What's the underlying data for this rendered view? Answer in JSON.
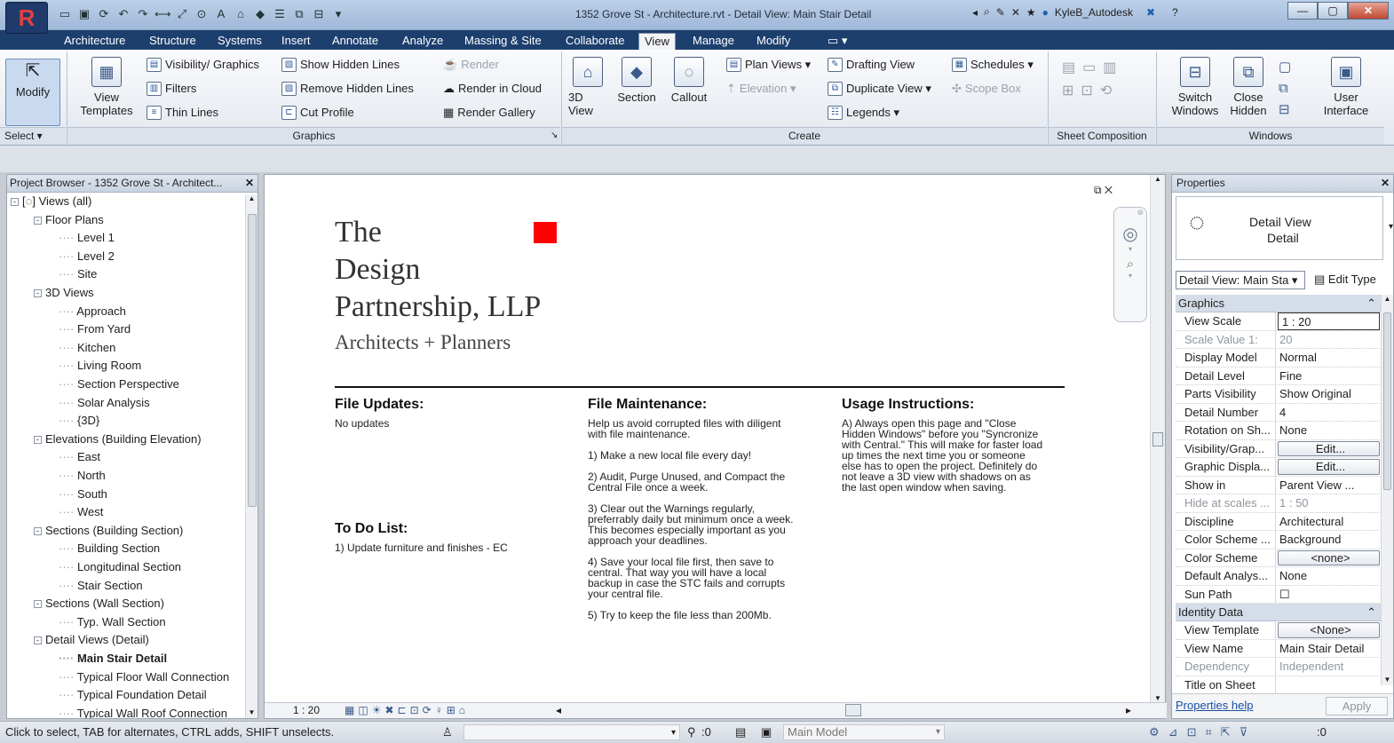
{
  "window": {
    "title": "1352 Grove St - Architecture.rvt - Detail View: Main Stair Detail",
    "user": "KyleB_Autodesk",
    "logo_letter": "R"
  },
  "ribbon_tabs": [
    "Architecture",
    "Structure",
    "Systems",
    "Insert",
    "Annotate",
    "Analyze",
    "Massing & Site",
    "Collaborate",
    "View",
    "Manage",
    "Modify"
  ],
  "active_tab": "View",
  "ribbon": {
    "modify": "Modify",
    "select": "Select ▾",
    "view_templates": "View Templates",
    "visibility_graphics": "Visibility/ Graphics",
    "filters": "Filters",
    "thin_lines": "Thin Lines",
    "show_hidden_lines": "Show Hidden Lines",
    "remove_hidden_lines": "Remove Hidden Lines",
    "cut_profile": "Cut Profile",
    "render": "Render",
    "render_in_cloud": "Render in Cloud",
    "render_gallery": "Render Gallery",
    "graphics_panel": "Graphics",
    "view_3d": "3D View",
    "section": "Section",
    "callout": "Callout",
    "plan_views": "Plan Views ▾",
    "elevation": "Elevation ▾",
    "drafting_view": "Drafting View",
    "duplicate_view": "Duplicate View ▾",
    "legends": "Legends ▾",
    "schedules": "Schedules ▾",
    "scope_box": "Scope Box",
    "create_panel": "Create",
    "sheet_composition_panel": "Sheet Composition",
    "switch_windows": "Switch Windows",
    "close_hidden": "Close Hidden",
    "user_interface": "User Interface",
    "windows_panel": "Windows"
  },
  "project_browser": {
    "title": "Project Browser - 1352 Grove St - Architect...",
    "items": [
      {
        "label": "Views (all)",
        "level": 0,
        "expand": "-"
      },
      {
        "label": "Floor Plans",
        "level": 1,
        "expand": "-"
      },
      {
        "label": "Level 1",
        "level": 2
      },
      {
        "label": "Level 2",
        "level": 2
      },
      {
        "label": "Site",
        "level": 2
      },
      {
        "label": "3D Views",
        "level": 1,
        "expand": "-"
      },
      {
        "label": "Approach",
        "level": 2
      },
      {
        "label": "From Yard",
        "level": 2
      },
      {
        "label": "Kitchen",
        "level": 2
      },
      {
        "label": "Living Room",
        "level": 2
      },
      {
        "label": "Section Perspective",
        "level": 2
      },
      {
        "label": "Solar Analysis",
        "level": 2
      },
      {
        "label": "{3D}",
        "level": 2
      },
      {
        "label": "Elevations (Building Elevation)",
        "level": 1,
        "expand": "-"
      },
      {
        "label": "East",
        "level": 2
      },
      {
        "label": "North",
        "level": 2
      },
      {
        "label": "South",
        "level": 2
      },
      {
        "label": "West",
        "level": 2
      },
      {
        "label": "Sections (Building Section)",
        "level": 1,
        "expand": "-"
      },
      {
        "label": "Building Section",
        "level": 2
      },
      {
        "label": "Longitudinal Section",
        "level": 2
      },
      {
        "label": "Stair Section",
        "level": 2
      },
      {
        "label": "Sections (Wall Section)",
        "level": 1,
        "expand": "-"
      },
      {
        "label": "Typ. Wall Section",
        "level": 2
      },
      {
        "label": "Detail Views (Detail)",
        "level": 1,
        "expand": "-"
      },
      {
        "label": "Main Stair Detail",
        "level": 2,
        "selected": true
      },
      {
        "label": "Typical Floor Wall Connection",
        "level": 2
      },
      {
        "label": "Typical Foundation Detail",
        "level": 2
      },
      {
        "label": "Typical Wall Roof Connection",
        "level": 2
      }
    ]
  },
  "drawing": {
    "firm_line1": "The",
    "firm_line2": "Design",
    "firm_line3": "Partnership, LLP",
    "firm_tagline": "Architects  +  Planners",
    "file_updates_title": "File Updates:",
    "file_updates_body": "No updates",
    "todo_title": "To Do List:",
    "todo_body": "1) Update furniture and finishes - EC",
    "maintenance_title": "File Maintenance:",
    "maintenance_body": "Help us avoid corrupted files with diligent\nwith file maintenance.\n\n1) Make a new local file every day!\n\n2) Audit, Purge Unused, and Compact the\nCentral File once a week.\n\n3) Clear out the Warnings regularly,\npreferrably daily but minimum once a week.\nThis becomes especially important as you\napproach your deadlines.\n\n4) Save your local file first, then save to\ncentral. That way you will have a local\nbackup in case the STC fails and corrupts\nyour central file.\n\n5) Try to keep the file less than 200Mb.",
    "usage_title": "Usage Instructions:",
    "usage_body": "A) Always open this page and \"Close\nHidden Windows\" before you \"Syncronize\nwith Central.\" This will make for faster load\nup times the next time you or someone\nelse has to open the project. Definitely do\nnot leave a 3D view with shadows on as\nthe last open window when saving."
  },
  "view_control": {
    "scale": "1 : 20"
  },
  "properties": {
    "title": "Properties",
    "type_line1": "Detail View",
    "type_line2": "Detail",
    "selector": "Detail View: Main Sta ▾",
    "edit_type": "Edit Type",
    "group_graphics": "Graphics",
    "group_identity": "Identity Data",
    "graphics_rows": [
      {
        "k": "View Scale",
        "v": "1 : 20",
        "style": "box"
      },
      {
        "k": "Scale Value    1:",
        "v": "20",
        "style": "grey"
      },
      {
        "k": "Display Model",
        "v": "Normal"
      },
      {
        "k": "Detail Level",
        "v": "Fine"
      },
      {
        "k": "Parts Visibility",
        "v": "Show Original"
      },
      {
        "k": "Detail Number",
        "v": "4"
      },
      {
        "k": "Rotation on Sh...",
        "v": "None"
      },
      {
        "k": "Visibility/Grap...",
        "v": "Edit...",
        "style": "btn"
      },
      {
        "k": "Graphic Displa...",
        "v": "Edit...",
        "style": "btn"
      },
      {
        "k": "Show in",
        "v": "Parent View ..."
      },
      {
        "k": "Hide at scales ...",
        "v": "1 : 50",
        "style": "grey"
      },
      {
        "k": "Discipline",
        "v": "Architectural"
      },
      {
        "k": "Color Scheme ...",
        "v": "Background"
      },
      {
        "k": "Color Scheme",
        "v": "<none>",
        "style": "btn"
      },
      {
        "k": "Default Analys...",
        "v": "None"
      },
      {
        "k": "Sun Path",
        "v": "☐"
      }
    ],
    "identity_rows": [
      {
        "k": "View Template",
        "v": "<None>",
        "style": "btn"
      },
      {
        "k": "View Name",
        "v": "Main Stair Detail"
      },
      {
        "k": "Dependency",
        "v": "Independent",
        "style": "grey"
      },
      {
        "k": "Title on Sheet",
        "v": ""
      }
    ],
    "help_link": "Properties help",
    "apply": "Apply"
  },
  "status": {
    "hint": "Click to select, TAB for alternates, CTRL adds, SHIFT unselects.",
    "zero1": ":0",
    "model": "Main Model",
    "zero2": ":0"
  }
}
